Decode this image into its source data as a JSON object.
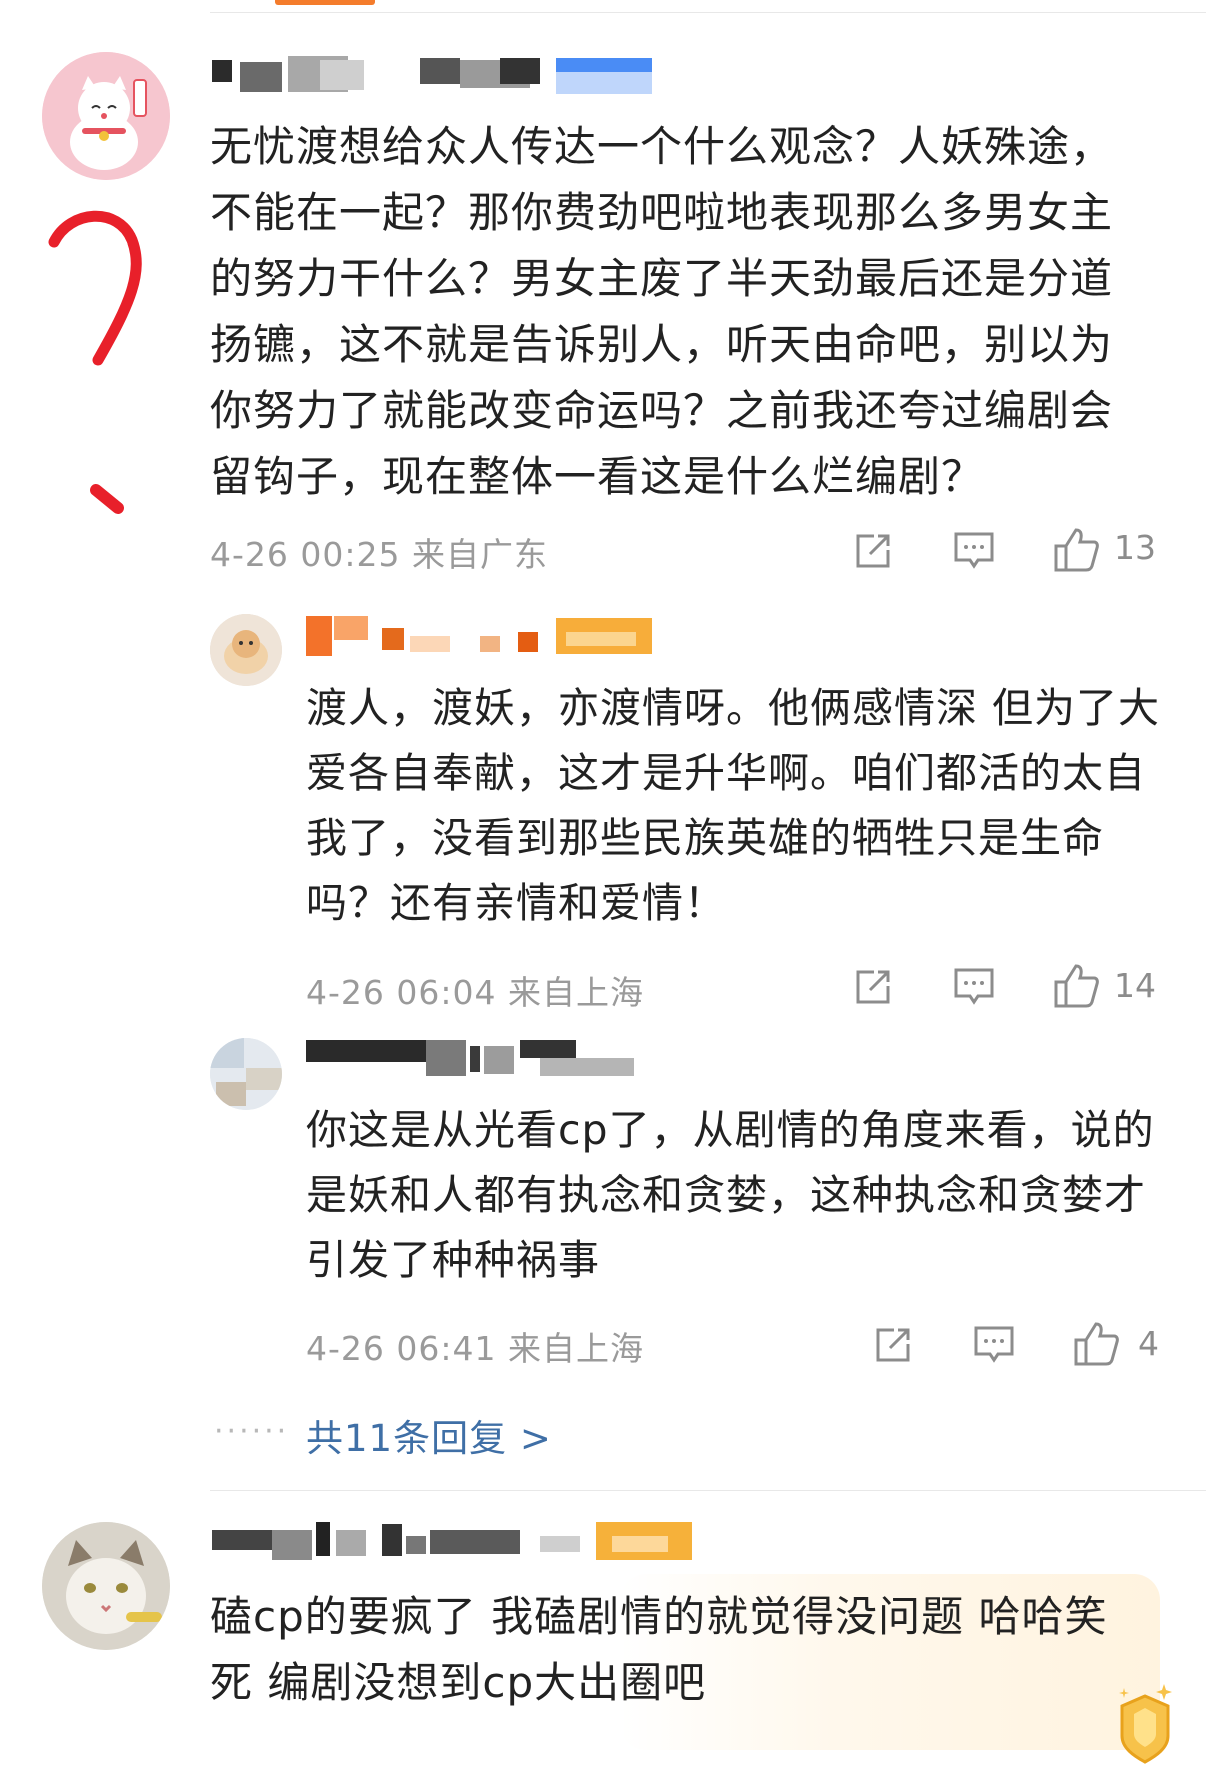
{
  "comments": [
    {
      "text": "无忧渡想给众人传达一个什么观念？人妖殊途，不能在一起？那你费劲吧啦地表现那么多男女主的努力干什么？男女主废了半天劲最后还是分道扬镳，这不就是告诉别人，听天由命吧，别以为你努力了就能改变命运吗？之前我还夸过编剧会留钩子，现在整体一看这是什么烂编剧？",
      "meta": "4-26 00:25 来自广东",
      "likes": "13",
      "replies": [
        {
          "text": "渡人，渡妖，亦渡情呀。他俩感情深 但为了大爱各自奉献，这才是升华啊。咱们都活的太自我了，没看到那些民族英雄的牺牲只是生命吗？还有亲情和爱情！",
          "meta": "4-26 06:04 来自上海",
          "likes": "14"
        },
        {
          "text": "你这是从光看cp了，从剧情的角度来看，说的是妖和人都有执念和贪婪，这种执念和贪婪才引发了种种祸事",
          "meta": "4-26 06:41 来自上海",
          "likes": "4"
        }
      ],
      "more_replies": "共11条回复 >"
    },
    {
      "text": "磕cp的要疯了 我磕剧情的就觉得没问题 哈哈笑死 编剧没想到cp大出圈吧"
    }
  ],
  "colors": {
    "accent_tab": "#f47c2c",
    "link": "#3f6fa6",
    "meta": "#9a9a9a",
    "annotation": "#e8202a"
  },
  "icons": [
    "share-icon",
    "comment-icon",
    "like-icon",
    "ellipsis-dots-icon",
    "badge-icon"
  ]
}
